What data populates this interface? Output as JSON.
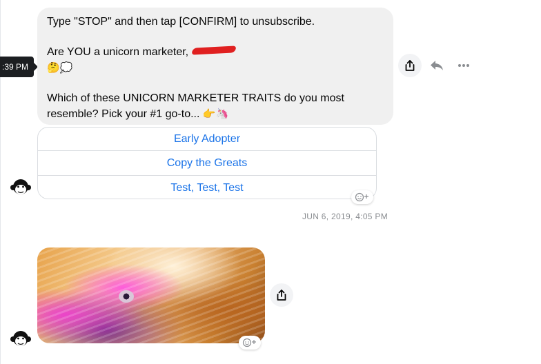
{
  "tooltip": {
    "time": ":39 PM"
  },
  "message": {
    "line1": "Type \"STOP\" and then tap [CONFIRM] to unsubscribe.",
    "line2": "Are YOU a unicorn marketer,",
    "line2_emoji": "🤔💭",
    "line3": "Which of these UNICORN MARKETER TRAITS do you most resemble? Pick your #1 go-to...",
    "line3_emoji": "👉🦄"
  },
  "quick_replies": [
    {
      "label": "Early Adopter"
    },
    {
      "label": "Copy the Greats"
    },
    {
      "label": "Test, Test, Test"
    }
  ],
  "date_separator": "JUN 6, 2019, 4:05 PM",
  "icons": {
    "share": "share-icon",
    "reply": "reply-icon",
    "more": "more-icon",
    "reaction": "add-reaction-icon",
    "avatar": "monkey-avatar-icon"
  },
  "colors": {
    "bubble_bg": "#f0f0f0",
    "link_blue": "#1a73e8",
    "tooltip_bg": "#1c1e21",
    "meta_gray": "#8a8d91"
  }
}
